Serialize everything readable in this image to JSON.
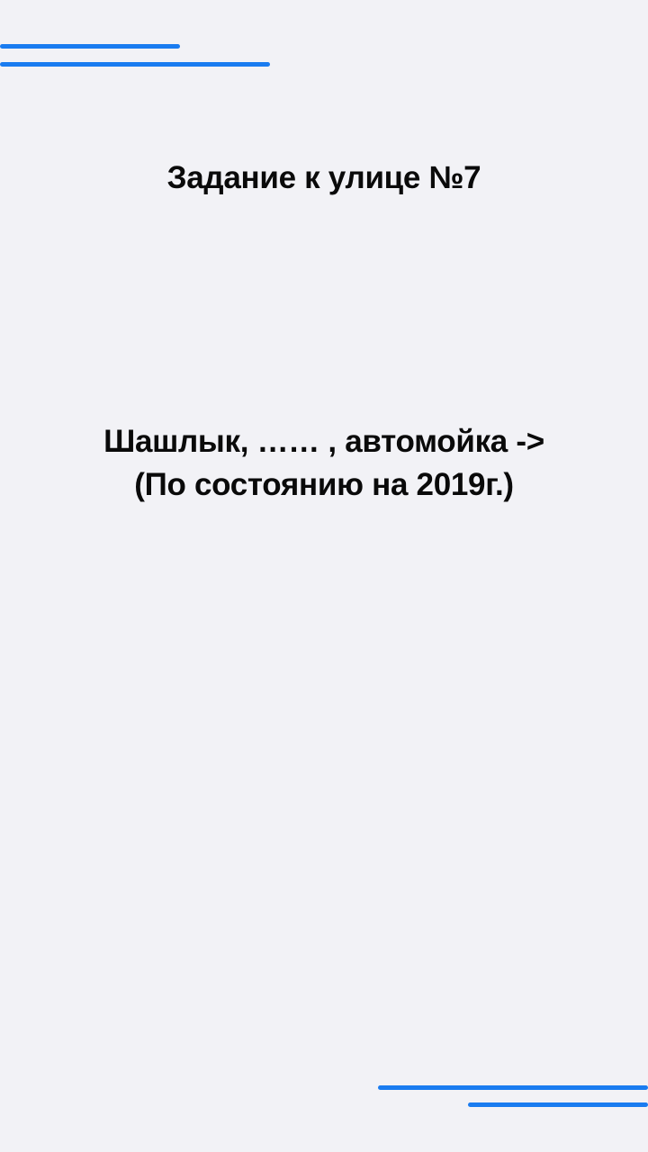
{
  "title": "Задание к улице №7",
  "task": {
    "line1": "Шашлык, …… , автомойка ->",
    "line2": "(По состоянию на 2019г.)"
  },
  "colors": {
    "accent": "#1a7cf0",
    "background": "#f2f2f6",
    "text": "#0a0a0a"
  }
}
